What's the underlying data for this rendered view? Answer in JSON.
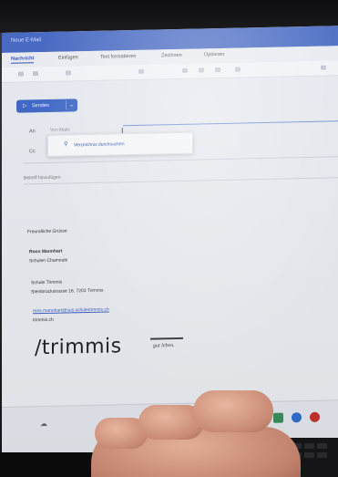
{
  "window": {
    "title": "Neue E-Mail"
  },
  "ribbon": {
    "tabs": [
      "Nachricht",
      "Einfügen",
      "Text formatieren",
      "Zeichnen",
      "Optionen"
    ]
  },
  "compose": {
    "send_label": "Senden",
    "to_label": "An",
    "to_value": "Von Mails",
    "cc_label": "Cc",
    "suggestion": "Verzeichnis durchsuchen",
    "subject_placeholder": "Betreff hinzufügen"
  },
  "signature": {
    "greeting": "Freundliche Grüsse",
    "name": "Roos Mannhart",
    "role": "Schulen Chamoule",
    "org": "Schule Trimmis",
    "address": "Steinbrückstrasse 16, 7203 Trimmis",
    "email": "roos.mannhart@sus.schuletrimmis.ch",
    "website": "trimmis.ch",
    "logo_text": "/trimmis",
    "logo_tagline": "gut leben."
  },
  "colors": {
    "accent": "#3d67c8",
    "titlebar": "#4467c4",
    "link": "#3b5fc6"
  }
}
